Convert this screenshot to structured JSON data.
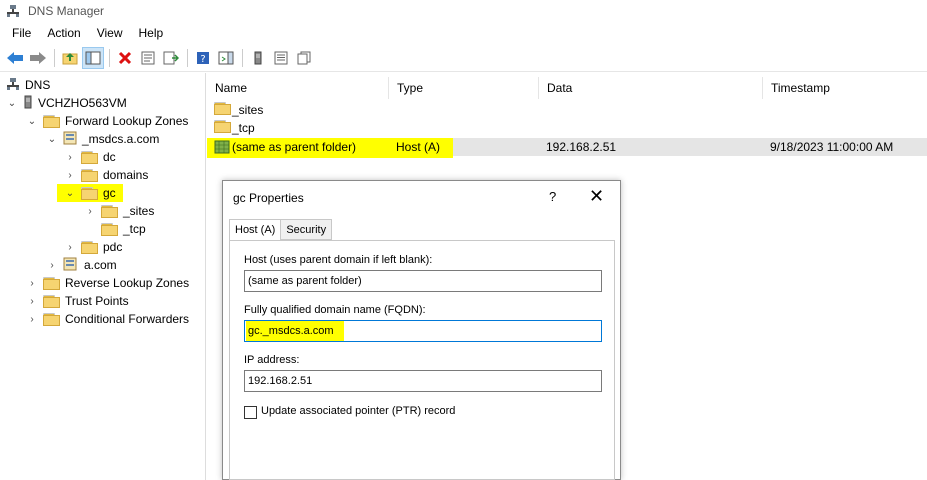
{
  "window": {
    "title": "DNS Manager"
  },
  "menu": [
    "File",
    "Action",
    "View",
    "Help"
  ],
  "toolbar": {
    "icons": [
      "back-arrow-icon",
      "forward-arrow-icon",
      "up-folder-icon",
      "show-hide-tree-icon",
      "delete-icon",
      "properties-icon",
      "export-list-icon",
      "help-icon",
      "action-pane-icon",
      "server-icon",
      "list-icon",
      "copy-icon"
    ]
  },
  "tree": {
    "root": "DNS",
    "server": "VCHZHO563VM",
    "forward_zones": "Forward Lookup Zones",
    "msdcs": "_msdcs.a.com",
    "dc": "dc",
    "domains": "domains",
    "gc": "gc",
    "gc_sites": "_sites",
    "gc_tcp": "_tcp",
    "pdc": "pdc",
    "acom": "a.com",
    "reverse_zones": "Reverse Lookup Zones",
    "trust_points": "Trust Points",
    "conditional_forwarders": "Conditional Forwarders"
  },
  "list": {
    "columns": {
      "name": "Name",
      "type": "Type",
      "data": "Data",
      "timestamp": "Timestamp"
    },
    "rows": [
      {
        "name": "_sites",
        "type": "",
        "data": "",
        "timestamp": ""
      },
      {
        "name": "_tcp",
        "type": "",
        "data": "",
        "timestamp": ""
      },
      {
        "name": "(same as parent folder)",
        "type": "Host (A)",
        "data": "192.168.2.51",
        "timestamp": "9/18/2023 11:00:00 AM"
      }
    ]
  },
  "dialog": {
    "title": "gc Properties",
    "help": "?",
    "close": "✕",
    "tabs": [
      "Host (A)",
      "Security"
    ],
    "host_label": "Host (uses parent domain if left blank):",
    "host_value": "(same as parent folder)",
    "fqdn_label": "Fully qualified domain name (FQDN):",
    "fqdn_value": "gc._msdcs.a.com",
    "ip_label": "IP address:",
    "ip_value": "192.168.2.51",
    "ptr_label": "Update associated pointer (PTR) record",
    "ptr_checked": false
  },
  "colors": {
    "highlight": "#ffff00",
    "focus": "#0078d7",
    "folder": "#f6d471"
  }
}
